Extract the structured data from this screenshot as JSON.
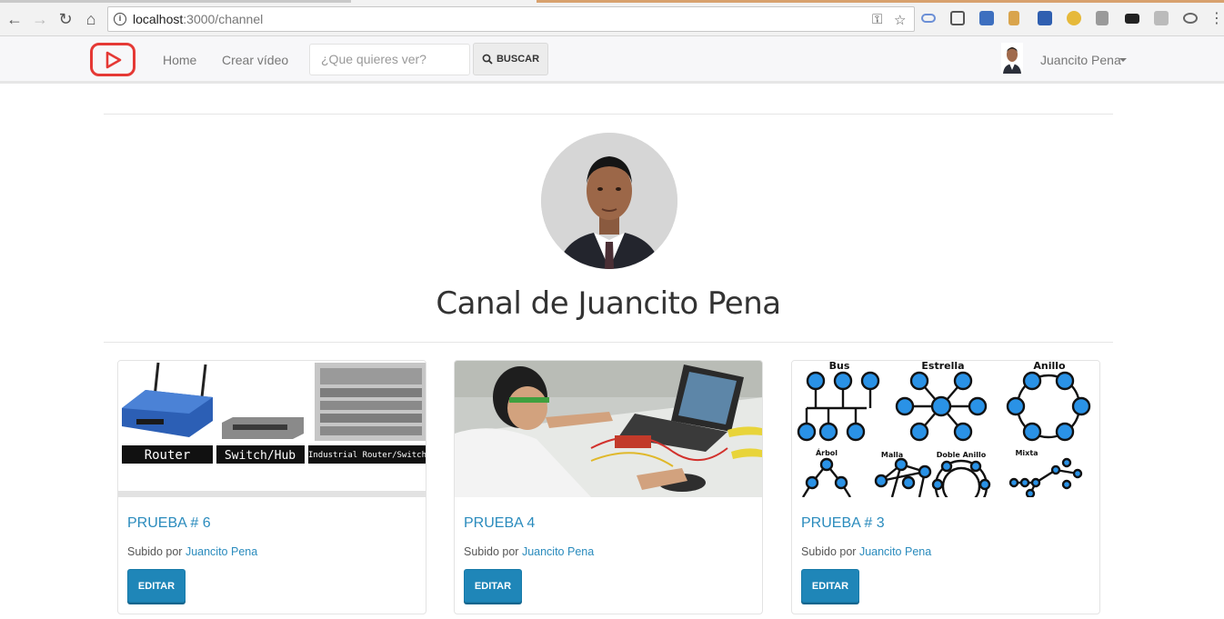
{
  "browser": {
    "url_host": "localhost",
    "url_path": ":3000/channel"
  },
  "navbar": {
    "logo_icon": "play-logo-icon",
    "links": [
      "Home",
      "Crear vídeo"
    ],
    "search_placeholder": "¿Que quieres ver?",
    "search_button": "BUSCAR",
    "user_name": "Juancito Pena"
  },
  "channel": {
    "title": "Canal de Juancito Pena"
  },
  "videos": [
    {
      "title": "PRUEBA # 6",
      "uploaded_by_label": "Subido por",
      "author": "Juancito Pena",
      "edit_label": "EDITAR",
      "thumb_labels": [
        "Router",
        "Switch/Hub",
        "Industrial Router/Switch"
      ]
    },
    {
      "title": "PRUEBA 4",
      "uploaded_by_label": "Subido por",
      "author": "Juancito Pena",
      "edit_label": "EDITAR",
      "thumb_labels": []
    },
    {
      "title": "PRUEBA # 3",
      "uploaded_by_label": "Subido por",
      "author": "Juancito Pena",
      "edit_label": "EDITAR",
      "thumb_labels": [
        "Bus",
        "Estrella",
        "Anillo",
        "Árbol",
        "Malla",
        "Doble Anillo",
        "Mixta"
      ]
    }
  ],
  "colors": {
    "link": "#2a8bbd",
    "button": "#1f86b8",
    "logo": "#e53935"
  }
}
